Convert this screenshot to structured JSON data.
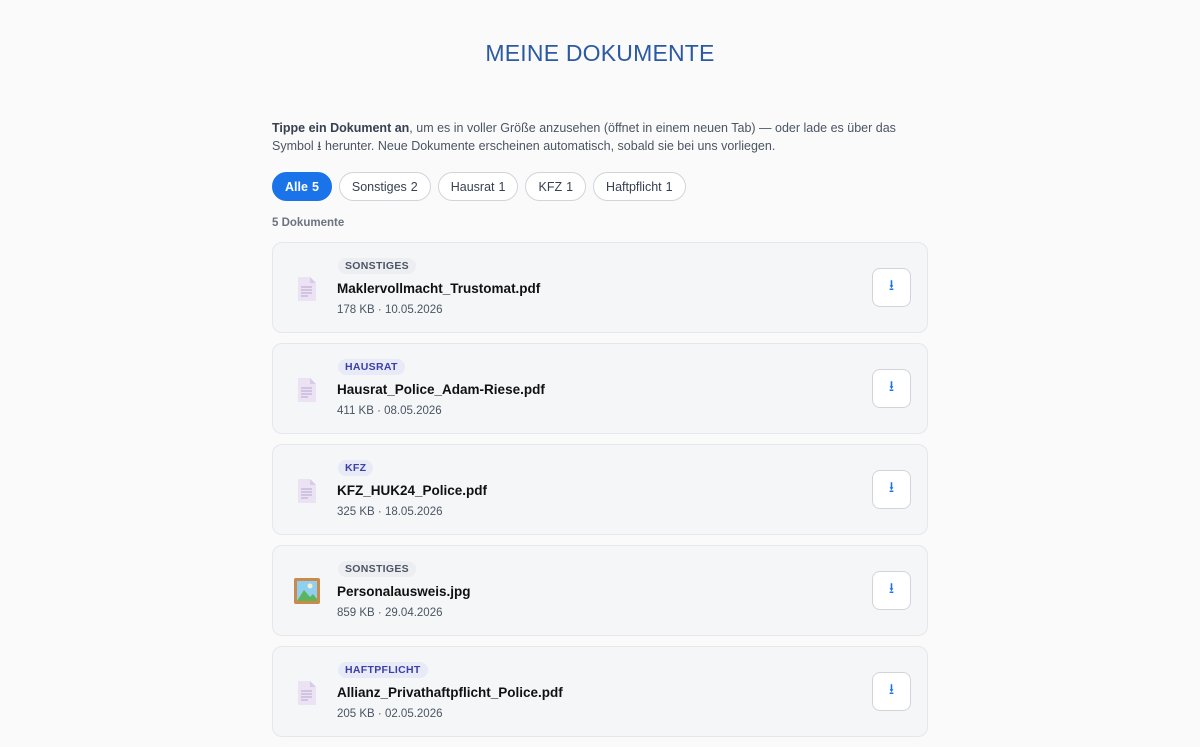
{
  "page": {
    "title": "MEINE DOKUMENTE"
  },
  "intro": {
    "bold": "Tippe ein Dokument an",
    "text1": ", um es in voller Größe anzusehen (öffnet in einem neuen Tab) — oder lade es über das Symbol ",
    "symbol": "⭳",
    "text2": " herunter. Neue Dokumente erscheinen automatisch, sobald sie bei uns vorliegen."
  },
  "filters": [
    {
      "label": "Alle",
      "count": "5",
      "active": true
    },
    {
      "label": "Sonstiges",
      "count": "2",
      "active": false
    },
    {
      "label": "Hausrat",
      "count": "1",
      "active": false
    },
    {
      "label": "KFZ",
      "count": "1",
      "active": false
    },
    {
      "label": "Haftpflicht",
      "count": "1",
      "active": false
    }
  ],
  "count_label": "5 Dokumente",
  "documents": [
    {
      "category": "SONSTIGES",
      "category_key": "sonstiges",
      "name": "Maklervollmacht_Trustomat.pdf",
      "meta": "178 KB · 10.05.2026",
      "icon": "pdf-file-icon"
    },
    {
      "category": "HAUSRAT",
      "category_key": "hausrat",
      "name": "Hausrat_Police_Adam-Riese.pdf",
      "meta": "411 KB · 08.05.2026",
      "icon": "pdf-file-icon"
    },
    {
      "category": "KFZ",
      "category_key": "kfz",
      "name": "KFZ_HUK24_Police.pdf",
      "meta": "325 KB · 18.05.2026",
      "icon": "pdf-file-icon"
    },
    {
      "category": "SONSTIGES",
      "category_key": "sonstiges",
      "name": "Personalausweis.jpg",
      "meta": "859 KB · 29.04.2026",
      "icon": "image-file-icon"
    },
    {
      "category": "HAFTPFLICHT",
      "category_key": "haftpflicht",
      "name": "Allianz_Privathaftpflicht_Police.pdf",
      "meta": "205 KB · 02.05.2026",
      "icon": "pdf-file-icon"
    }
  ],
  "download_symbol": "⭳",
  "colors": {
    "accent": "#1a73e8",
    "title": "#2c5aa0",
    "badge_text": "#3b3fa6"
  }
}
